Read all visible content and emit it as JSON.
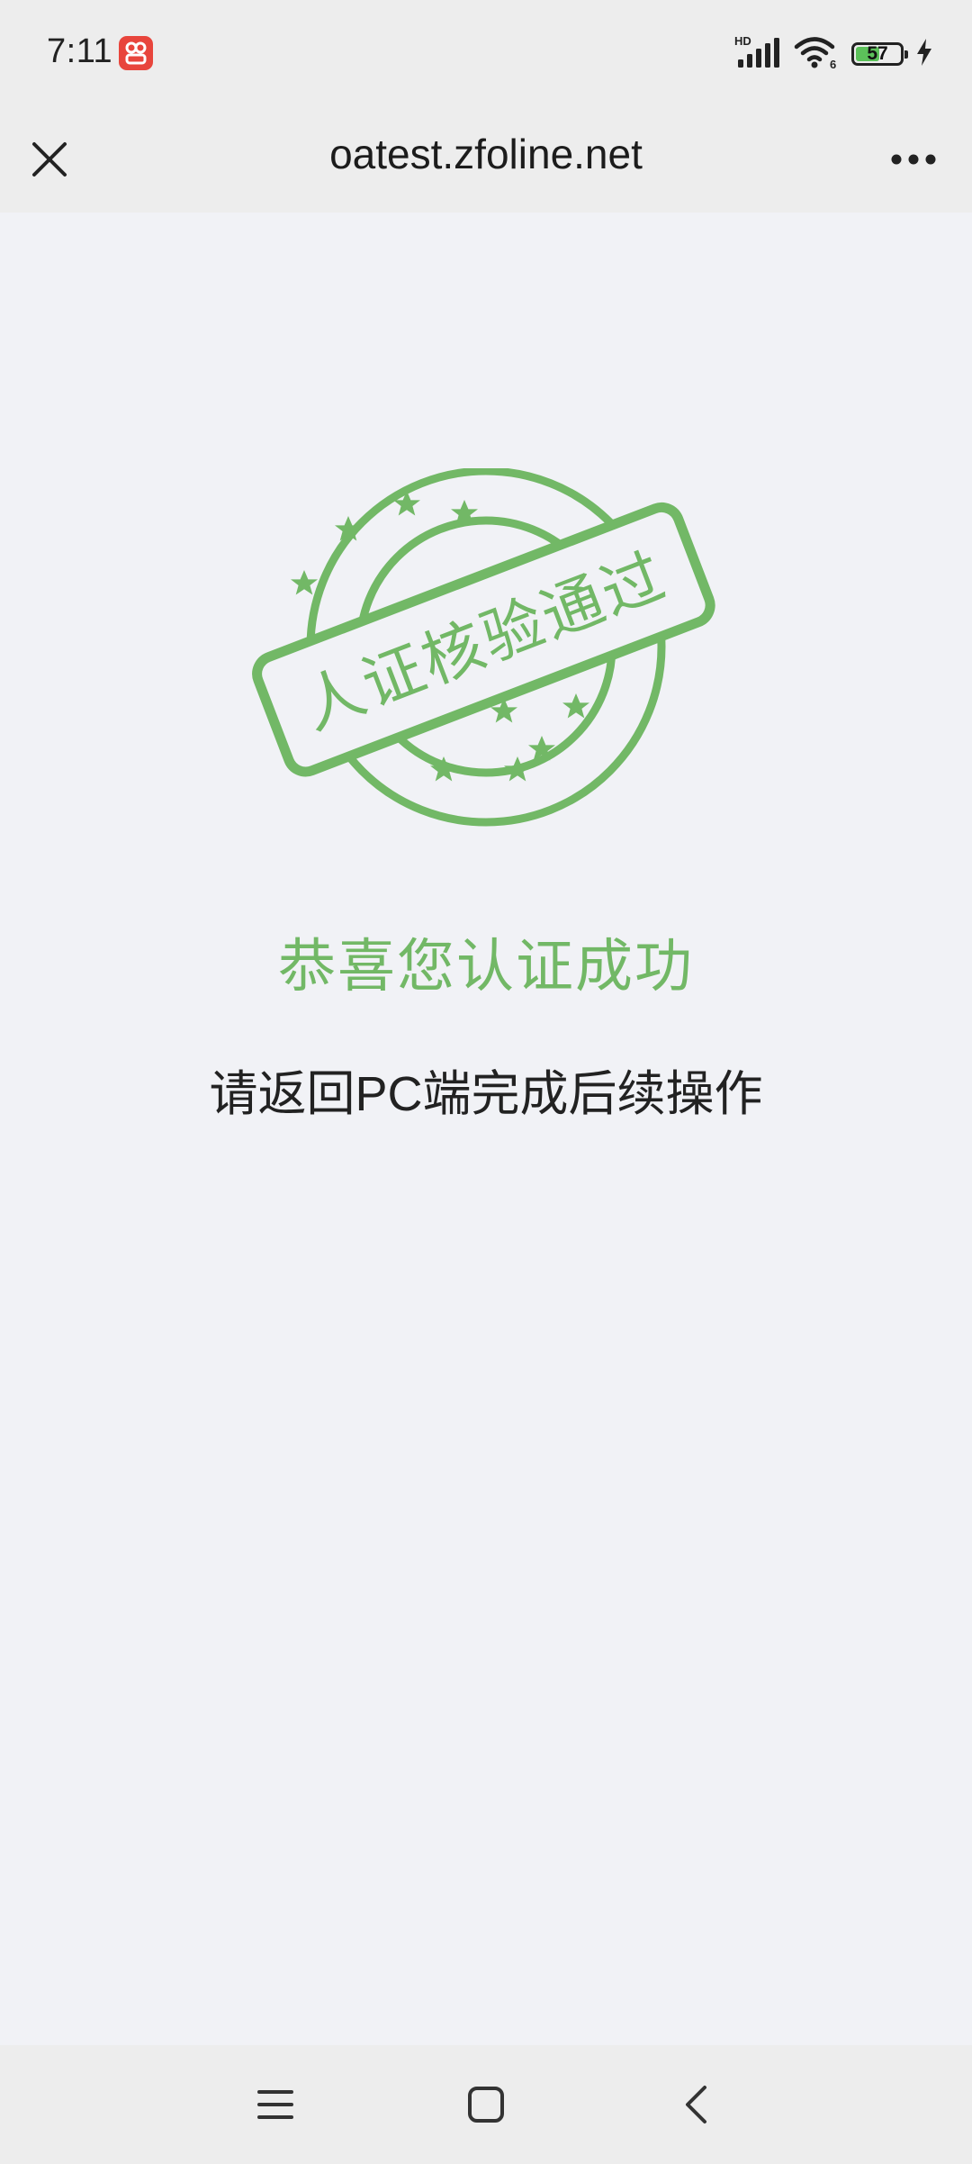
{
  "status_bar": {
    "time": "7:11",
    "signal_label": "HD",
    "wifi_label": "6",
    "battery_level": "57",
    "icons": [
      "app-badge-icon",
      "signal-icon",
      "wifi-icon",
      "battery-icon",
      "charging-icon"
    ]
  },
  "title_bar": {
    "url": "oatest.zfoline.net",
    "close_icon": "close-icon",
    "more_icon": "more-icon"
  },
  "main": {
    "stamp_text": "人证核验通过",
    "success_title": "恭喜您认证成功",
    "success_message": "请返回PC端完成后续操作"
  },
  "nav_bar": {
    "icons": [
      "menu-icon",
      "home-icon",
      "back-icon"
    ]
  },
  "colors": {
    "accent_green": "#72b866",
    "background": "#f1f2f6",
    "bar_background": "#ededed",
    "text": "#222222"
  }
}
